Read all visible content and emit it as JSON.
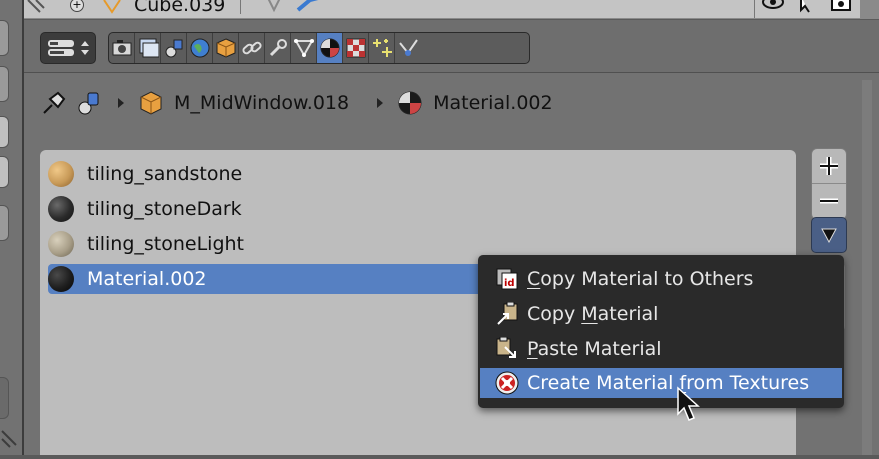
{
  "outliner_row": {
    "object_name": "Cube.039"
  },
  "header": {
    "context_tabs": [
      "render",
      "render-layers",
      "scene",
      "world",
      "object",
      "constraints",
      "modifiers",
      "data",
      "material",
      "texture",
      "particles",
      "physics"
    ],
    "active_tab": "material"
  },
  "breadcrumb": {
    "object": "M_MidWindow.018",
    "material": "Material.002"
  },
  "material_slots": [
    {
      "name": "tiling_sandstone",
      "color": "#c89a58"
    },
    {
      "name": "tiling_stoneDark",
      "color": "#2b2b2b"
    },
    {
      "name": "tiling_stoneLight",
      "color": "#a89e88"
    },
    {
      "name": "Material.002",
      "color": "#1e1e1e",
      "selected": true
    }
  ],
  "side_buttons": {
    "add": "+",
    "remove": "−",
    "specials": "▼"
  },
  "context_menu": {
    "items": [
      {
        "pre": "",
        "key": "C",
        "post": "opy Material to Others"
      },
      {
        "pre": "Copy ",
        "key": "M",
        "post": "aterial"
      },
      {
        "pre": "",
        "key": "P",
        "post": "aste Material"
      },
      {
        "pre": "Create Material ",
        "key": "f",
        "post": "rom Textures",
        "highlighted": true
      }
    ]
  },
  "colors": {
    "accent": "#5680c2",
    "menu_bg": "#2a2a2a",
    "list_bg": "#bdbdbd",
    "panel_bg": "#727272"
  }
}
